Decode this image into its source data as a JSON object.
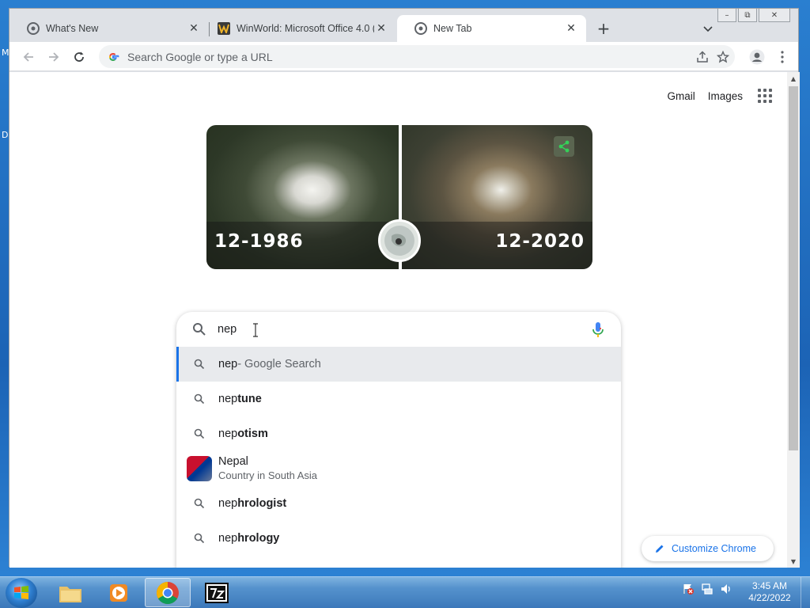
{
  "desktop": {
    "glyph_top": "M",
    "glyph_mid": "D"
  },
  "window": {
    "caption": {
      "minimize": "–",
      "restore": "⧉",
      "close": "✕"
    }
  },
  "tabs": [
    {
      "title": "What's New",
      "icon": "chrome-icon",
      "active": false
    },
    {
      "title": "WinWorld: Microsoft Office 4.0 (",
      "icon": "winworld-icon",
      "active": false
    },
    {
      "title": "New Tab",
      "icon": "chrome-icon",
      "active": true
    }
  ],
  "tab_close": "✕",
  "new_tab": "+",
  "omnibox": {
    "placeholder": "Search Google or type a URL"
  },
  "page": {
    "links": {
      "gmail": "Gmail",
      "images": "Images"
    },
    "doodle": {
      "left_date": "12-1986",
      "right_date": "12-2020"
    },
    "search": {
      "query": "nep",
      "suggestions": [
        {
          "typed": "nep",
          "rest": "",
          "suffix": " - Google Search",
          "selected": true
        },
        {
          "typed": "nep",
          "rest": "tune",
          "suffix": ""
        },
        {
          "typed": "nep",
          "rest": "otism",
          "suffix": ""
        },
        {
          "entity": true,
          "title": "Nepal",
          "subtitle": "Country in South Asia"
        },
        {
          "typed": "nep",
          "rest": "hrologist",
          "suffix": ""
        },
        {
          "typed": "nep",
          "rest": "hrology",
          "suffix": ""
        }
      ]
    },
    "customize_label": "Customize Chrome"
  },
  "taskbar": {
    "clock_time": "3:45 AM",
    "clock_date": "4/22/2022",
    "items": [
      "file-explorer-icon",
      "media-player-icon",
      "chrome-icon",
      "7zip-icon"
    ]
  },
  "colors": {
    "accent": "#1a73e8",
    "taskbar": "#3c78ba",
    "selection_bar": "#1a73e8"
  }
}
